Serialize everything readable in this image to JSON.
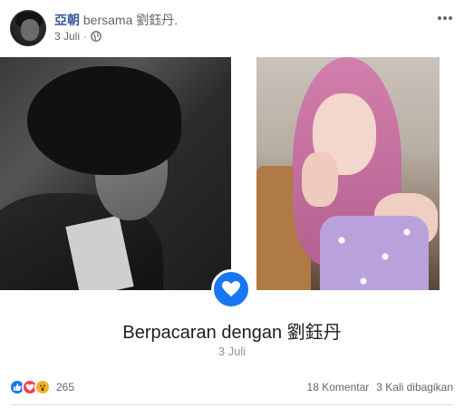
{
  "post": {
    "author": "亞朝",
    "with_text": "bersama",
    "tagged": "劉鈺丹",
    "tagged_suffix": ".",
    "date": "3 Juli",
    "dot": "·",
    "privacy_icon": "globe-icon",
    "more_icon": "more-horizontal-icon"
  },
  "life_event": {
    "title": "Berpacaran dengan 劉鈺丹",
    "date": "3 Juli",
    "icon": "heart-icon"
  },
  "footer": {
    "reaction_count": "265",
    "comments": "18 Komentar",
    "shares": "3 Kali dibagikan"
  },
  "colors": {
    "link": "#385898",
    "accent": "#1877f2",
    "love": "#f33e58",
    "wow": "#f7b125"
  }
}
